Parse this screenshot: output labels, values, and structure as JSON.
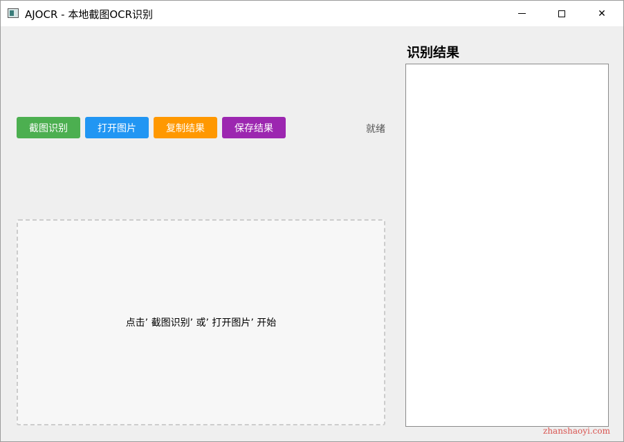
{
  "window": {
    "title": "AJOCR - 本地截图OCR识别",
    "icon": "app-window-icon",
    "controls": {
      "minimize_icon": "minimize-icon",
      "maximize_icon": "maximize-icon",
      "close_glyph": "✕"
    }
  },
  "toolbar": {
    "capture_label": "截图识别",
    "open_label": "打开图片",
    "copy_label": "复制结果",
    "save_label": "保存结果",
    "colors": {
      "capture": "#4caf50",
      "open": "#2196f3",
      "copy": "#ff9800",
      "save": "#9c27b0"
    }
  },
  "status": {
    "text": "就绪"
  },
  "image_area": {
    "hint": "点击’ 截图识别’ 或’ 打开图片’ 开始"
  },
  "result": {
    "title": "识别结果",
    "text": ""
  },
  "watermark": {
    "text": "zhanshaoyi.com",
    "color": "#d9534f"
  }
}
